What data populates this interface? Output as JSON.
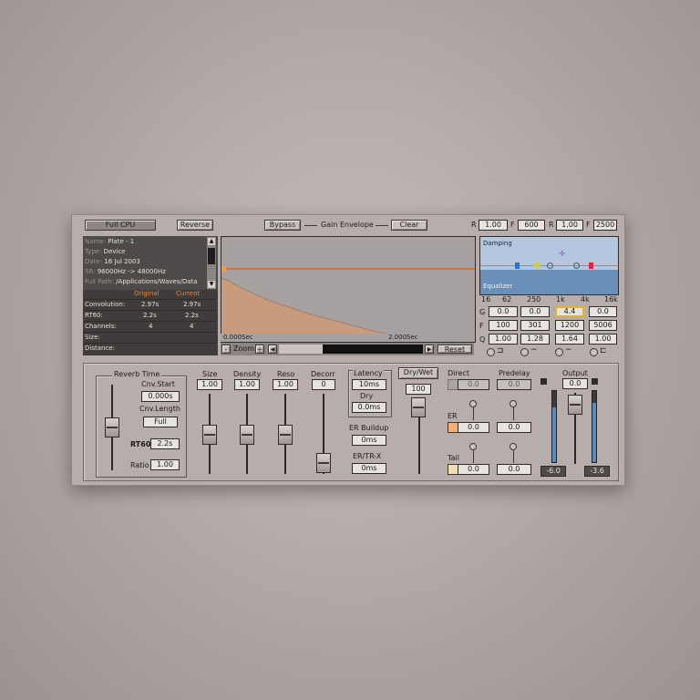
{
  "toolbar": {
    "full_cpu": "Full CPU",
    "reverse": "Reverse",
    "bypass": "Bypass",
    "gain_envelope": "Gain Envelope",
    "clear": "Clear",
    "r1_label": "R",
    "r1_value": "1.00",
    "f_label": "F",
    "f_value": "600",
    "r2_label": "R",
    "r2_value": "1.00",
    "f2_label": "F",
    "f2_value": "2500"
  },
  "info": {
    "name_key": "Name:",
    "name_val": "Plate - 1",
    "type_key": "Type:",
    "type_val": "Device",
    "date_key": "Date:",
    "date_val": "16 Jul 2003",
    "sr_key": "SR:",
    "sr_val": "96000Hz -> 48000Hz",
    "path_key": "Full Path:",
    "path_val": "/Applications/Waves/Data"
  },
  "table": {
    "col_original": "Original",
    "col_current": "Current",
    "rows": [
      {
        "label": "Convolution:",
        "original": "2.97s",
        "current": "2.97s"
      },
      {
        "label": "RT60:",
        "original": "2.2s",
        "current": "2.2s"
      },
      {
        "label": "Channels:",
        "original": "4",
        "current": "4"
      },
      {
        "label": "Size:",
        "original": "",
        "current": ""
      },
      {
        "label": "Distance:",
        "original": "",
        "current": ""
      }
    ]
  },
  "graph": {
    "time_start": "0.000Sec",
    "time_end": "2.000Sec",
    "zoom_minus": "-",
    "zoom_label": "Zoom",
    "zoom_plus": "+",
    "reset": "Reset"
  },
  "eq": {
    "damping": "Damping",
    "equalizer": "Equalizer",
    "freq_labels": [
      "16",
      "62",
      "250",
      "1k",
      "4k",
      "16k"
    ],
    "row_g_label": "G",
    "row_g": [
      "0.0",
      "0.0",
      "4.4",
      "0.0"
    ],
    "row_f_label": "F",
    "row_f": [
      "100",
      "301",
      "1200",
      "5006"
    ],
    "row_q_label": "Q",
    "row_q": [
      "1.00",
      "1.28",
      "1.64",
      "1.00"
    ]
  },
  "reverb_time": {
    "title": "Reverb Time",
    "cnv_start_label": "Cnv.Start",
    "cnv_start_value": "0.000s",
    "cnv_length_label": "Cnv.Length",
    "cnv_length_value": "Full",
    "rt60_label": "RT60",
    "rt60_value": "2.2s",
    "ratio_label": "Ratio",
    "ratio_value": "1.00"
  },
  "faders": {
    "size_label": "Size",
    "size_value": "1.00",
    "density_label": "Density",
    "density_value": "1.00",
    "reso_label": "Reso",
    "reso_value": "1.00",
    "decorr_label": "Decorr",
    "decorr_value": "0"
  },
  "latency": {
    "title": "Latency",
    "value": "10ms",
    "dry_label": "Dry",
    "dry_value": "0.0ms",
    "er_buildup_label": "ER Buildup",
    "er_buildup_value": "0ms",
    "ertr_label": "ER/TR-X",
    "ertr_value": "0ms"
  },
  "mix": {
    "dry_wet_label": "Dry/Wet",
    "dry_wet_value": "100",
    "direct_label": "Direct",
    "direct_value": "0.0",
    "direct_pre": "0.0",
    "predelay_label": "Predelay",
    "er_label": "ER",
    "er_value": "0.0",
    "er_pre": "0.0",
    "tail_label": "Tail",
    "tail_value": "0.0",
    "tail_pre": "0.0"
  },
  "output": {
    "label": "Output",
    "value": "0.0",
    "meter_left": "-6.0",
    "meter_right": "-3.6"
  },
  "colors": {
    "panel": "#b7aeab",
    "accent": "#e38a3a",
    "eq_blue": "#6a8fb8"
  }
}
